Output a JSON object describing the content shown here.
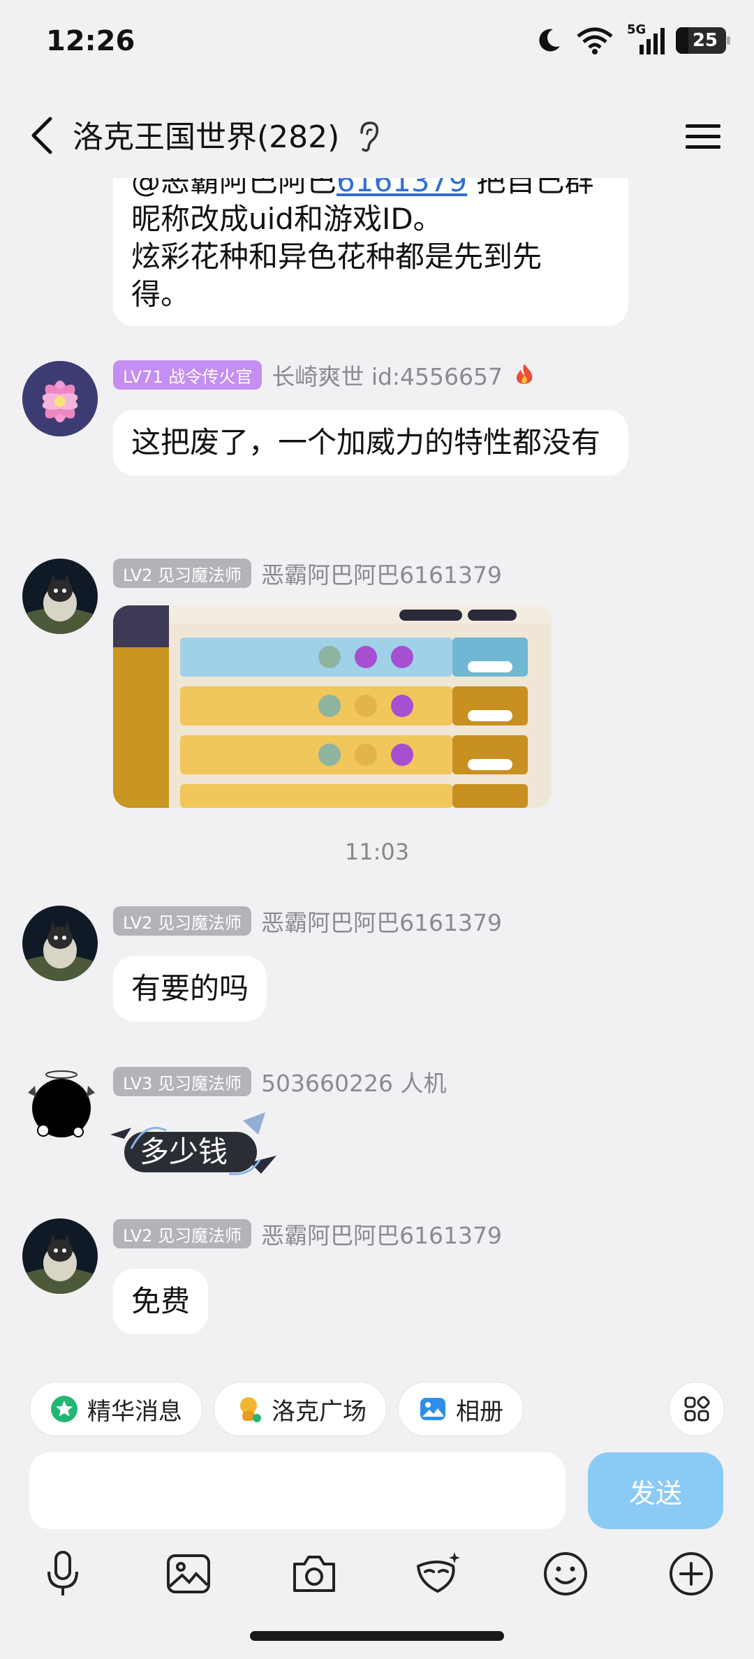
{
  "status_bar": {
    "time": "12:26",
    "battery": "25",
    "network": "5G"
  },
  "header": {
    "title": "洛克王国世界(282)"
  },
  "messages": {
    "m0": {
      "line1": "@恶霸阿巴阿巴6161379 把自己群",
      "line2": "昵称改成uid和游戏ID。",
      "line3": "炫彩花种和异色花种都是先到先",
      "line4": "得。"
    },
    "m1": {
      "badge": "LV71 战令传火官",
      "sender": "长崎爽世 id:4556657",
      "text": "这把废了，一个加威力的特性都没有"
    },
    "m2": {
      "badge": "LV2 见习魔法师",
      "sender": "恶霸阿巴阿巴6161379"
    },
    "time_divider": "11:03",
    "m3": {
      "badge": "LV2 见习魔法师",
      "sender": "恶霸阿巴阿巴6161379",
      "text": "有要的吗"
    },
    "m4": {
      "badge": "LV3 见习魔法师",
      "sender": "503660226  人机",
      "text": "多少钱"
    },
    "m5": {
      "badge": "LV2 见习魔法师",
      "sender": "恶霸阿巴阿巴6161379",
      "text": "免费"
    }
  },
  "shortcuts": {
    "essence": "精华消息",
    "plaza": "洛克广场",
    "album": "相册"
  },
  "input": {
    "send_label": "发送"
  },
  "colors": {
    "send": "#8ccaf6",
    "badge_purple": "#c48ef2",
    "badge_gray": "#b3b3b8",
    "link": "#2f6fd6"
  }
}
